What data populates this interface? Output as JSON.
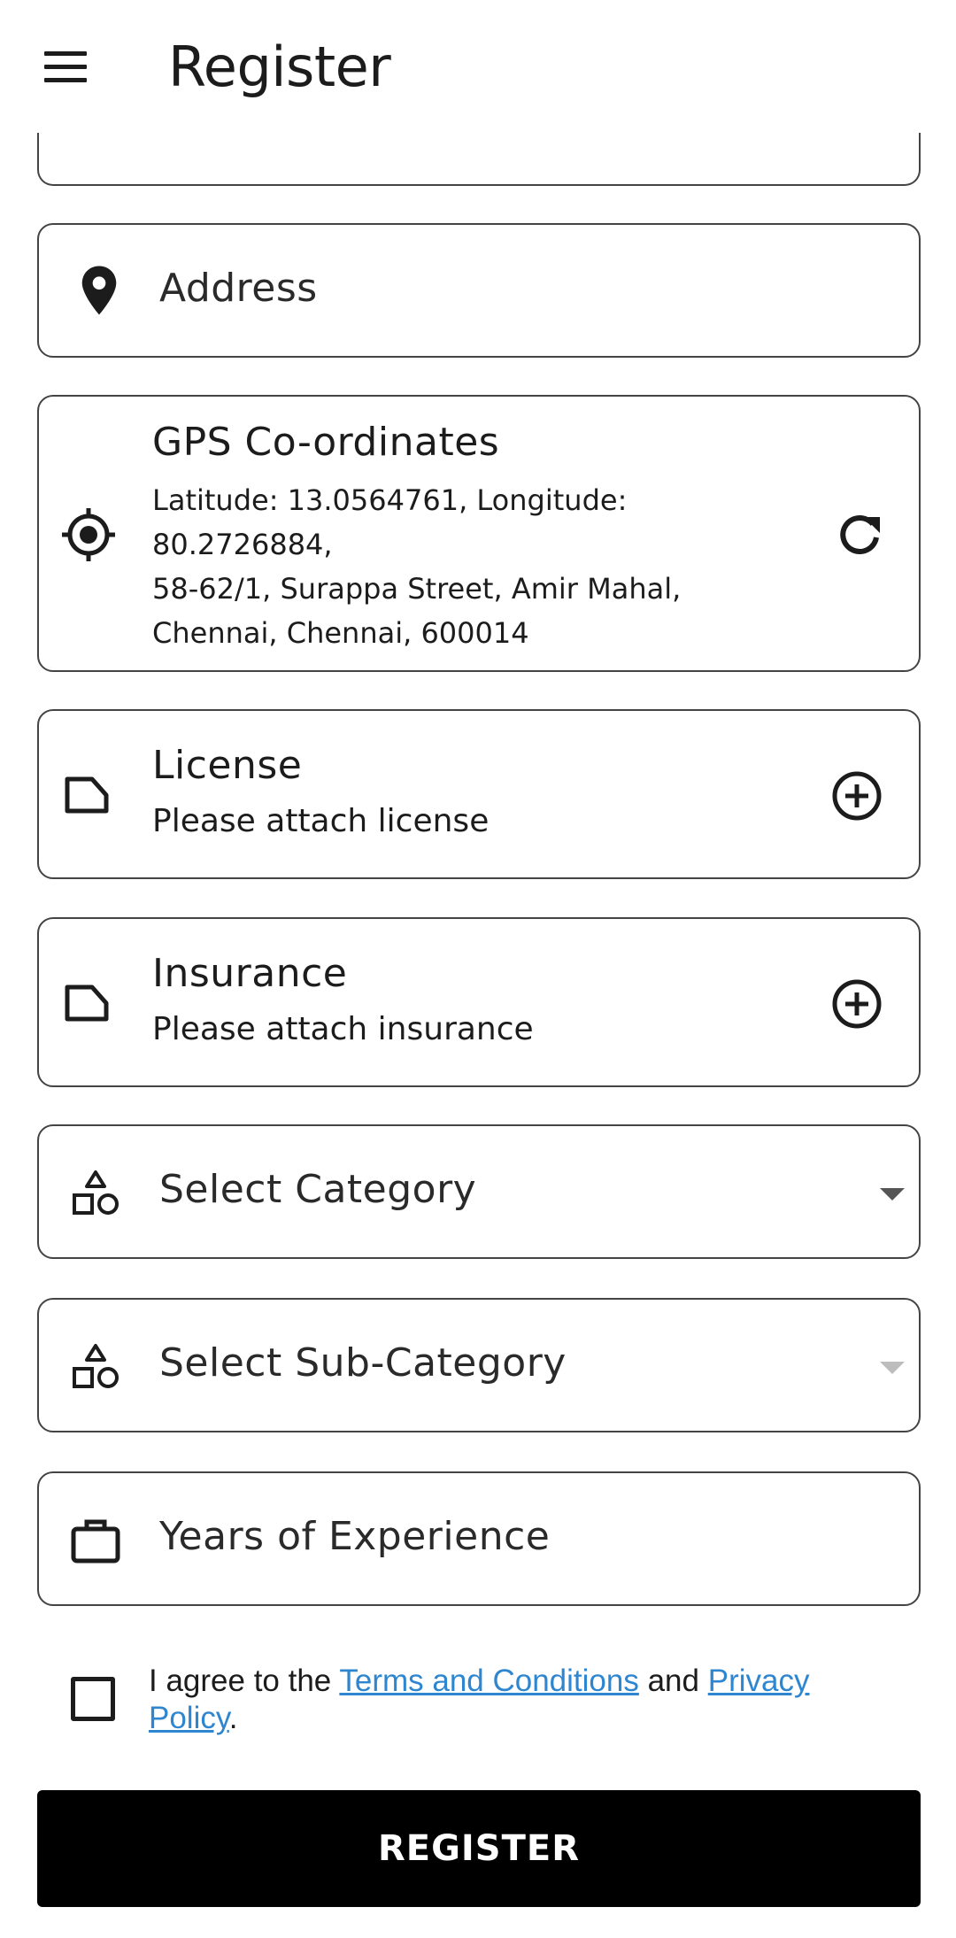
{
  "appbar": {
    "title": "Register",
    "menu_icon": "menu-icon"
  },
  "address": {
    "placeholder": "Address",
    "icon": "location-pin-icon"
  },
  "gps": {
    "title": "GPS Co-ordinates",
    "coords": "Latitude: 13.0564761, Longitude: 80.2726884,",
    "address": "58-62/1, Surappa Street, Amir Mahal, Chennai, Chennai, 600014",
    "icon": "gps-target-icon",
    "action_icon": "refresh-icon"
  },
  "license": {
    "title": "License",
    "subtitle": "Please attach license",
    "icon": "label-tag-icon",
    "action_icon": "add-circle-icon"
  },
  "insurance": {
    "title": "Insurance",
    "subtitle": "Please attach insurance",
    "icon": "label-tag-icon",
    "action_icon": "add-circle-icon"
  },
  "category": {
    "placeholder": "Select Category",
    "icon": "category-shapes-icon"
  },
  "subcategory": {
    "placeholder": "Select Sub-Category",
    "icon": "category-shapes-icon"
  },
  "experience": {
    "placeholder": "Years of Experience",
    "icon": "briefcase-icon"
  },
  "terms": {
    "prefix": "I agree to the ",
    "terms_link": "Terms and Conditions",
    "middle": " and ",
    "privacy_link": "Privacy Policy",
    "suffix": ".",
    "link_color": "#2f86d0",
    "checked": false
  },
  "register": {
    "label": "REGISTER",
    "color": "#000000"
  }
}
